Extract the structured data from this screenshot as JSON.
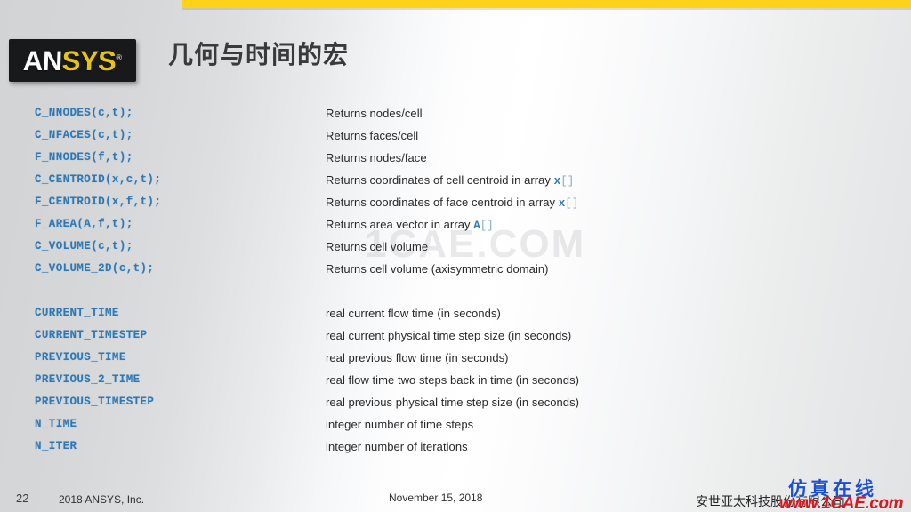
{
  "slide": {
    "title": "几何与时间的宏",
    "logo": {
      "part1": "AN",
      "part2": "SYS",
      "registered": "®"
    },
    "accent_color": "#fdd218",
    "code_color": "#2e79b5"
  },
  "watermarks": {
    "center": "1CAE.COM",
    "bottom_right_cn": "仿真在线",
    "bottom_right_url": "www.1CAE.com",
    "bottom_right_cn_color": "#1c4fd8",
    "bottom_right_url_color": "#e0141c"
  },
  "groups": [
    {
      "name": "geometry-macros",
      "rows": [
        {
          "code": "C_NNODES(c,t);",
          "desc_pre": "Returns nodes/cell",
          "array": "",
          "desc_post": ""
        },
        {
          "code": "C_NFACES(c,t);",
          "desc_pre": "Returns faces/cell",
          "array": "",
          "desc_post": ""
        },
        {
          "code": "F_NNODES(f,t);",
          "desc_pre": "Returns nodes/face",
          "array": "",
          "desc_post": ""
        },
        {
          "code": "C_CENTROID(x,c,t);",
          "desc_pre": "Returns coordinates of cell centroid in array ",
          "array": "x",
          "desc_post": ""
        },
        {
          "code": "F_CENTROID(x,f,t);",
          "desc_pre": "Returns coordinates of face centroid in array ",
          "array": "x",
          "desc_post": ""
        },
        {
          "code": "F_AREA(A,f,t);",
          "desc_pre": "Returns area vector in array ",
          "array": "A",
          "desc_post": ""
        },
        {
          "code": "C_VOLUME(c,t);",
          "desc_pre": "Returns cell volume",
          "array": "",
          "desc_post": ""
        },
        {
          "code": "C_VOLUME_2D(c,t);",
          "desc_pre": "Returns cell volume (axisymmetric domain)",
          "array": "",
          "desc_post": ""
        }
      ]
    },
    {
      "name": "time-macros",
      "rows": [
        {
          "code": "CURRENT_TIME",
          "desc_pre": "real current flow time (in seconds)",
          "array": "",
          "desc_post": ""
        },
        {
          "code": "CURRENT_TIMESTEP",
          "desc_pre": "real current physical time step size (in seconds)",
          "array": "",
          "desc_post": ""
        },
        {
          "code": "PREVIOUS_TIME",
          "desc_pre": "real previous flow time (in seconds)",
          "array": "",
          "desc_post": ""
        },
        {
          "code": "PREVIOUS_2_TIME",
          "desc_pre": "real flow time two steps back in time (in seconds)",
          "array": "",
          "desc_post": ""
        },
        {
          "code": "PREVIOUS_TIMESTEP",
          "desc_pre": "real previous physical time step size (in seconds)",
          "array": "",
          "desc_post": ""
        },
        {
          "code": "N_TIME",
          "desc_pre": "integer number of time steps",
          "array": "",
          "desc_post": ""
        },
        {
          "code": "N_ITER",
          "desc_pre": "integer number of iterations",
          "array": "",
          "desc_post": ""
        }
      ]
    }
  ],
  "footer": {
    "page_number": "22",
    "copyright": "2018  ANSYS, Inc.",
    "date": "November 15, 2018",
    "company": "安世亚太科技股份有限公司"
  }
}
